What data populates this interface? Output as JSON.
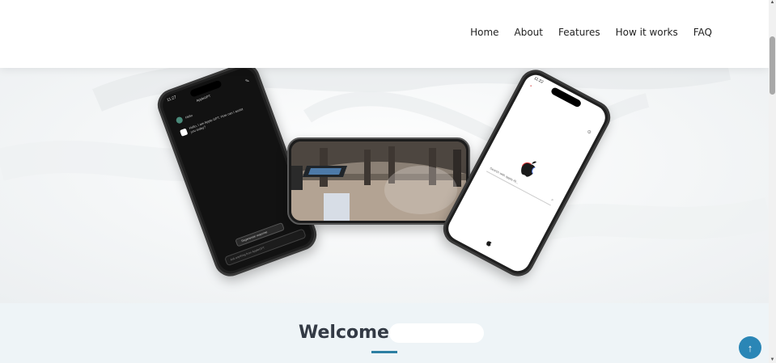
{
  "nav": {
    "items": [
      {
        "label": "Home"
      },
      {
        "label": "About"
      },
      {
        "label": "Features"
      },
      {
        "label": "How it works"
      },
      {
        "label": "FAQ"
      }
    ]
  },
  "phone_left": {
    "time": "11:27",
    "app_title": "AppleGPT",
    "user_name": "Hello",
    "message": "Hello, I am Apple GPT. How can I assist you today?",
    "regenerate_label": "Regenerate response",
    "input_placeholder": "Ask anything from AppleGPT"
  },
  "phone_right": {
    "time": "11:22",
    "search_placeholder": "Search with apple AI..."
  },
  "welcome": {
    "title": "Welcome to"
  },
  "colors": {
    "accent": "#2a86b6",
    "underline": "#2d7fa3",
    "heading": "#333a45"
  }
}
